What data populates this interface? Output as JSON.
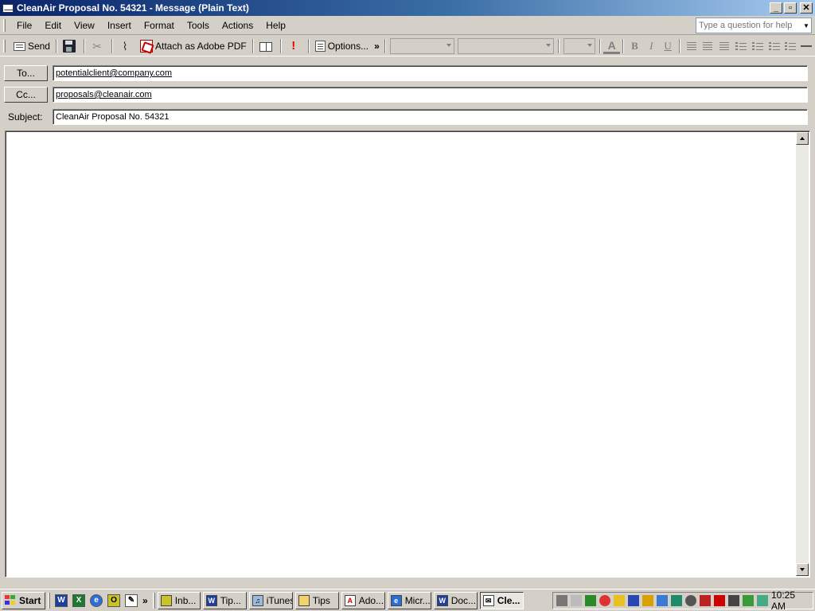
{
  "window": {
    "title": "CleanAir Proposal No. 54321 - Message (Plain Text)"
  },
  "menu": {
    "items": [
      "File",
      "Edit",
      "View",
      "Insert",
      "Format",
      "Tools",
      "Actions",
      "Help"
    ],
    "help_placeholder": "Type a question for help"
  },
  "toolbar": {
    "send_label": "Send",
    "attach_pdf_label": "Attach as Adobe PDF",
    "options_label": "Options..."
  },
  "header": {
    "to_button": "To...",
    "cc_button": "Cc...",
    "subject_label": "Subject:",
    "to_value": "potentialclient@company.com",
    "cc_value": "proposals@cleanair.com",
    "subject_value": "CleanAir Proposal No. 54321"
  },
  "body": {
    "text": ""
  },
  "taskbar": {
    "start_label": "Start",
    "tasks": [
      "Inb...",
      "Tip...",
      "iTunes",
      "Tips",
      "Ado...",
      "Micr...",
      "Doc...",
      "Cle..."
    ],
    "clock": "10:25 AM"
  }
}
